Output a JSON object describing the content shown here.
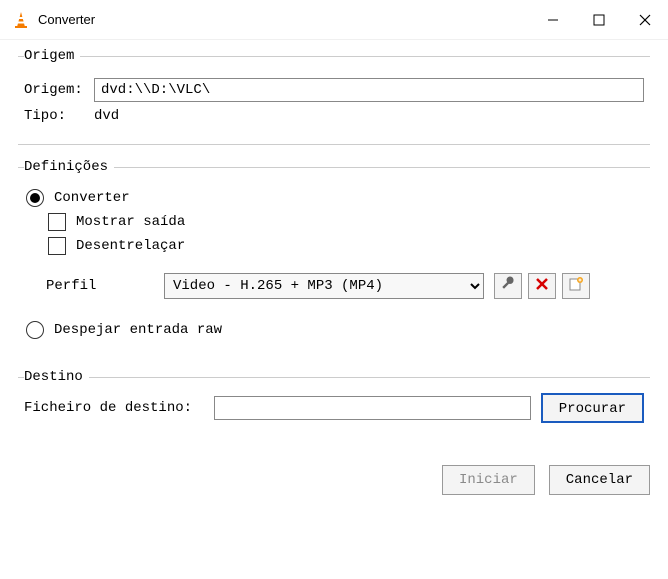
{
  "window": {
    "title": "Converter"
  },
  "origin": {
    "legend": "Origem",
    "label": "Origem:",
    "value": "dvd:\\\\D:\\VLC\\",
    "type_label": "Tipo:",
    "type_value": "dvd"
  },
  "settings": {
    "legend": "Definições",
    "convert_label": "Converter",
    "show_output_label": "Mostrar saída",
    "deinterlace_label": "Desentrelaçar",
    "profile_label": "Perfil",
    "profile_value": "Video - H.265 + MP3 (MP4)",
    "raw_dump_label": "Despejar entrada raw",
    "icons": {
      "wrench": "wrench",
      "delete": "delete",
      "new": "new"
    }
  },
  "destination": {
    "legend": "Destino",
    "file_label": "Ficheiro de destino:",
    "file_value": "",
    "browse_label": "Procurar"
  },
  "footer": {
    "start_label": "Iniciar",
    "cancel_label": "Cancelar"
  }
}
